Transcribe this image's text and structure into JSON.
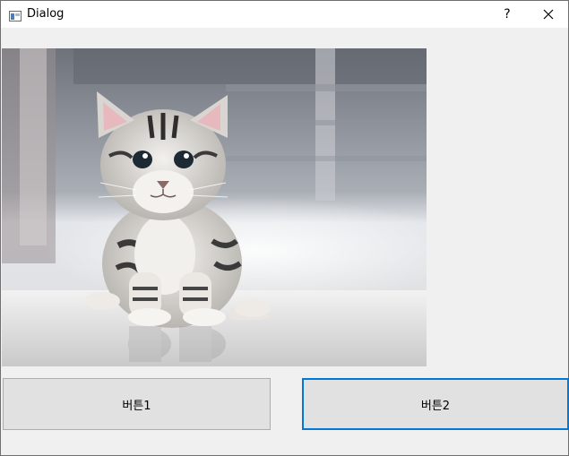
{
  "window": {
    "title": "Dialog",
    "help_label": "?",
    "close_icon": "close-icon",
    "app_icon": "dialog-window-icon"
  },
  "image": {
    "subject": "kitten photo",
    "colors": {
      "background_dark": "#7d8088",
      "floor": "#e6e6e6",
      "fur_light": "#e8e4e0",
      "fur_dark": "#3a3a3a",
      "eye": "#1e2a33",
      "ear_inner": "#e7b8bd"
    }
  },
  "buttons": {
    "button1_label": "버튼1",
    "button2_label": "버튼2"
  },
  "colors": {
    "focus_border": "#0078d7",
    "button_face": "#e1e1e1",
    "dialog_bg": "#f0f0f0"
  }
}
